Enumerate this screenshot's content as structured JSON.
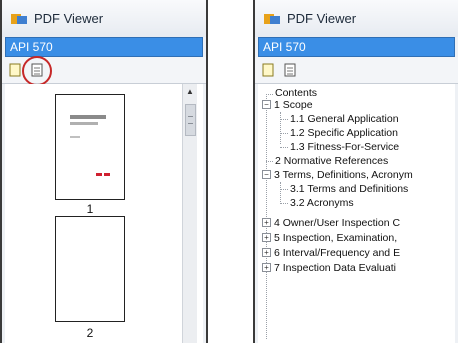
{
  "left": {
    "title": "PDF Viewer",
    "document": "API 570",
    "toolbar": {
      "bookmarks_icon": "bookmark-icon",
      "pages_icon": "page-thumbnail-icon"
    },
    "thumbnails": [
      {
        "label": "1"
      },
      {
        "label": "2"
      }
    ]
  },
  "right": {
    "title": "PDF Viewer",
    "document": "API 570",
    "toolbar": {
      "bookmarks_icon": "bookmark-icon",
      "pages_icon": "page-thumbnail-icon"
    },
    "tree": {
      "root": "Contents",
      "items": [
        {
          "label": "1 Scope",
          "expander": "−"
        },
        {
          "label": "1.1 General Application"
        },
        {
          "label": "1.2 Specific Application"
        },
        {
          "label": "1.3 Fitness-For-Service"
        },
        {
          "label": "2 Normative References"
        },
        {
          "label": "3 Terms, Definitions, Acronym",
          "expander": "−"
        },
        {
          "label": "3.1 Terms and Definitions"
        },
        {
          "label": "3.2 Acronyms"
        },
        {
          "label": "4 Owner/User Inspection C",
          "expander": "+"
        },
        {
          "label": "5 Inspection, Examination,",
          "expander": "+"
        },
        {
          "label": "6 Interval/Frequency and E",
          "expander": "+"
        },
        {
          "label": "7 Inspection Data Evaluati",
          "expander": "+"
        }
      ]
    }
  },
  "colors": {
    "selection": "#3a8ee6",
    "highlight": "#c62828"
  }
}
